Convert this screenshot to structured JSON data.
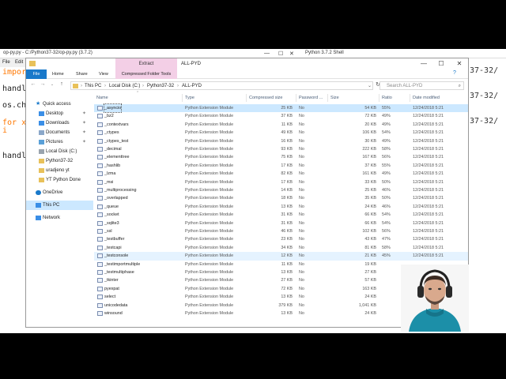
{
  "editor": {
    "title": "op-py.py - C:/Python37-32/op-py.py (3.7.2)",
    "title_short": "op-py.py",
    "menu": [
      "File",
      "Edit"
    ],
    "code_lines": [
      "impor",
      "handl",
      "os.ch",
      "for x",
      "    i",
      "handl"
    ]
  },
  "shell": {
    "title": "Python 3.7.2 Shell",
    "lines": [
      "37-32/",
      "37-32/",
      "37-32/"
    ]
  },
  "explorer": {
    "contextual_tab": "Extract",
    "window_title": "ALL-PYD",
    "controls": [
      "—",
      "☐",
      "✕"
    ],
    "ribbon_tabs": [
      "File",
      "Home",
      "Share",
      "View",
      "Compressed Folder Tools"
    ],
    "breadcrumb": [
      "This PC",
      "Local Disk (C:)",
      "Python37-32",
      "ALL-PYD"
    ],
    "search_placeholder": "Search ALL-PYD",
    "nav": {
      "quick_access": "Quick access",
      "items": [
        {
          "label": "Desktop",
          "pinned": true
        },
        {
          "label": "Downloads",
          "pinned": true
        },
        {
          "label": "Documents",
          "pinned": true
        },
        {
          "label": "Pictures",
          "pinned": true
        },
        {
          "label": "Local Disk (C:)",
          "pinned": false
        },
        {
          "label": "Python37-32",
          "pinned": false
        },
        {
          "label": "uradjeno yt",
          "pinned": false
        },
        {
          "label": "YT Python Done",
          "pinned": false
        }
      ],
      "onedrive": "OneDrive",
      "thispc": "This PC",
      "network": "Network",
      "pin_glyph": "📌"
    },
    "columns": [
      "Name",
      "Type",
      "Compressed size",
      "Password ...",
      "Size",
      "Ratio",
      "Date modified"
    ],
    "files": [
      {
        "name": "_asyncio",
        "type": "Python Extension Module",
        "csize": "25 KB",
        "pw": "No",
        "size": "54 KB",
        "ratio": "55%",
        "date": "12/24/2018 5:21"
      },
      {
        "name": "_bz2",
        "type": "Python Extension Module",
        "csize": "37 KB",
        "pw": "No",
        "size": "72 KB",
        "ratio": "49%",
        "date": "12/24/2018 5:21"
      },
      {
        "name": "_contextvars",
        "type": "Python Extension Module",
        "csize": "11 KB",
        "pw": "No",
        "size": "20 KB",
        "ratio": "49%",
        "date": "12/24/2018 5:21"
      },
      {
        "name": "_ctypes",
        "type": "Python Extension Module",
        "csize": "49 KB",
        "pw": "No",
        "size": "106 KB",
        "ratio": "54%",
        "date": "12/24/2018 5:21"
      },
      {
        "name": "_ctypes_test",
        "type": "Python Extension Module",
        "csize": "16 KB",
        "pw": "No",
        "size": "30 KB",
        "ratio": "49%",
        "date": "12/24/2018 5:21"
      },
      {
        "name": "_decimal",
        "type": "Python Extension Module",
        "csize": "93 KB",
        "pw": "No",
        "size": "222 KB",
        "ratio": "58%",
        "date": "12/24/2018 5:21"
      },
      {
        "name": "_elementtree",
        "type": "Python Extension Module",
        "csize": "75 KB",
        "pw": "No",
        "size": "167 KB",
        "ratio": "56%",
        "date": "12/24/2018 5:21"
      },
      {
        "name": "_hashlib",
        "type": "Python Extension Module",
        "csize": "17 KB",
        "pw": "No",
        "size": "37 KB",
        "ratio": "55%",
        "date": "12/24/2018 5:21"
      },
      {
        "name": "_lzma",
        "type": "Python Extension Module",
        "csize": "82 KB",
        "pw": "No",
        "size": "161 KB",
        "ratio": "49%",
        "date": "12/24/2018 5:21"
      },
      {
        "name": "_msi",
        "type": "Python Extension Module",
        "csize": "17 KB",
        "pw": "No",
        "size": "33 KB",
        "ratio": "50%",
        "date": "12/24/2018 5:21"
      },
      {
        "name": "_multiprocessing",
        "type": "Python Extension Module",
        "csize": "14 KB",
        "pw": "No",
        "size": "25 KB",
        "ratio": "46%",
        "date": "12/24/2018 5:21"
      },
      {
        "name": "_overlapped",
        "type": "Python Extension Module",
        "csize": "18 KB",
        "pw": "No",
        "size": "35 KB",
        "ratio": "50%",
        "date": "12/24/2018 5:21"
      },
      {
        "name": "_queue",
        "type": "Python Extension Module",
        "csize": "13 KB",
        "pw": "No",
        "size": "24 KB",
        "ratio": "46%",
        "date": "12/24/2018 5:21"
      },
      {
        "name": "_socket",
        "type": "Python Extension Module",
        "csize": "31 KB",
        "pw": "No",
        "size": "66 KB",
        "ratio": "54%",
        "date": "12/24/2018 5:21"
      },
      {
        "name": "_sqlite3",
        "type": "Python Extension Module",
        "csize": "31 KB",
        "pw": "No",
        "size": "66 KB",
        "ratio": "54%",
        "date": "12/24/2018 5:21"
      },
      {
        "name": "_ssl",
        "type": "Python Extension Module",
        "csize": "46 KB",
        "pw": "No",
        "size": "102 KB",
        "ratio": "56%",
        "date": "12/24/2018 5:21"
      },
      {
        "name": "_testbuffer",
        "type": "Python Extension Module",
        "csize": "23 KB",
        "pw": "No",
        "size": "43 KB",
        "ratio": "47%",
        "date": "12/24/2018 5:21"
      },
      {
        "name": "_testcapi",
        "type": "Python Extension Module",
        "csize": "34 KB",
        "pw": "No",
        "size": "81 KB",
        "ratio": "58%",
        "date": "12/24/2018 5:21"
      },
      {
        "name": "_testconsole",
        "type": "Python Extension Module",
        "csize": "12 KB",
        "pw": "No",
        "size": "21 KB",
        "ratio": "45%",
        "date": "12/24/2018 5:21"
      },
      {
        "name": "_testimportmultiple",
        "type": "Python Extension Module",
        "csize": "11 KB",
        "pw": "No",
        "size": "19 KB",
        "ratio": "",
        "date": ""
      },
      {
        "name": "_testmultiphase",
        "type": "Python Extension Module",
        "csize": "13 KB",
        "pw": "No",
        "size": "27 KB",
        "ratio": "",
        "date": ""
      },
      {
        "name": "_tkinter",
        "type": "Python Extension Module",
        "csize": "27 KB",
        "pw": "No",
        "size": "57 KB",
        "ratio": "",
        "date": ""
      },
      {
        "name": "pyexpat",
        "type": "Python Extension Module",
        "csize": "72 KB",
        "pw": "No",
        "size": "163 KB",
        "ratio": "",
        "date": ""
      },
      {
        "name": "select",
        "type": "Python Extension Module",
        "csize": "13 KB",
        "pw": "No",
        "size": "24 KB",
        "ratio": "",
        "date": ""
      },
      {
        "name": "unicodedata",
        "type": "Python Extension Module",
        "csize": "379 KB",
        "pw": "No",
        "size": "1,041 KB",
        "ratio": "",
        "date": ""
      },
      {
        "name": "winsound",
        "type": "Python Extension Module",
        "csize": "13 KB",
        "pw": "No",
        "size": "24 KB",
        "ratio": "",
        "date": ""
      }
    ]
  },
  "colors": {
    "accent": "#1979ca",
    "contextual": "#f3cfe6",
    "selection": "#cce8ff"
  }
}
